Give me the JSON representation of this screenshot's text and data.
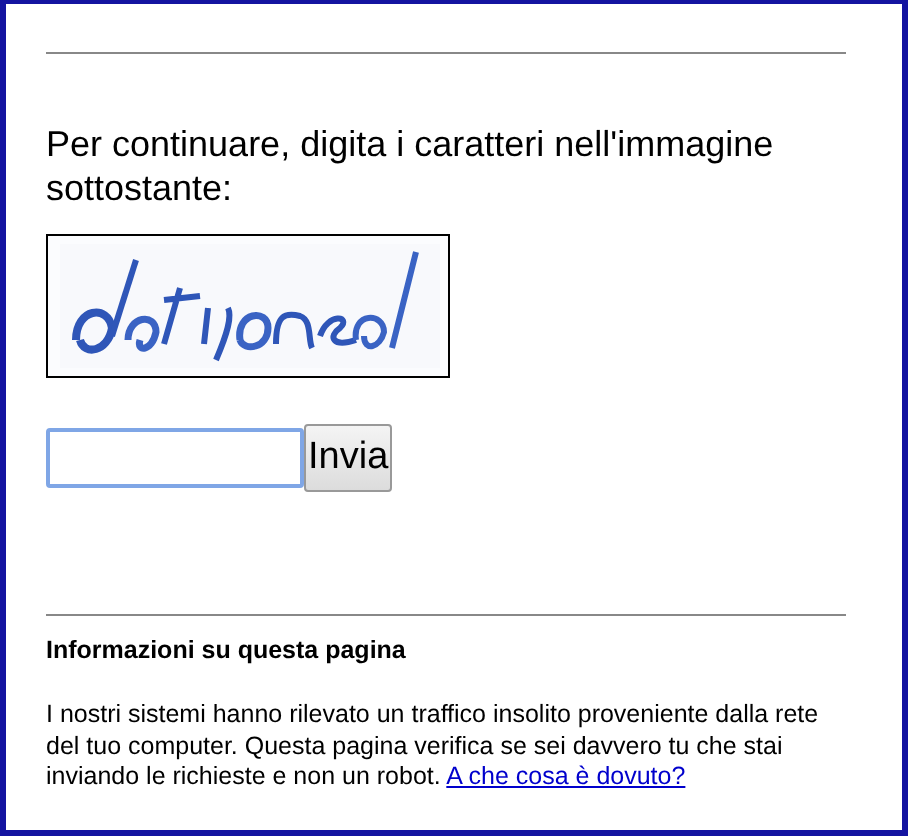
{
  "prompt": "Per continuare, digita i caratteri nell'immagine sottostante:",
  "answer": {
    "focused": true
  },
  "submit_button": "Invia",
  "info": {
    "title": "Informazioni su questa pagina",
    "text": "I nostri sistemi hanno rilevato un traffico insolito proveniente dalla rete del tuo computer. Questa pagina verifica se sei davvero tu che stai inviando le richieste e non un robot.",
    "link": "A che cosa è dovuto?"
  }
}
